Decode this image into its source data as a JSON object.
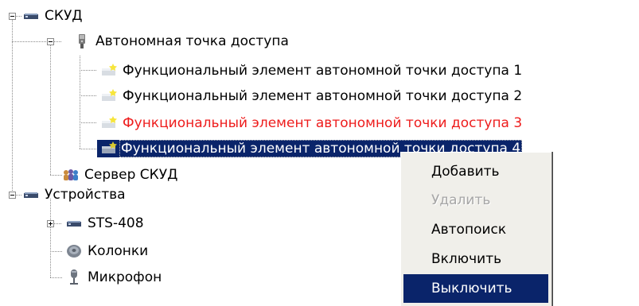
{
  "tree": {
    "nodes": [
      {
        "label": "СКУД",
        "icon": "device-icon",
        "expander": "minus"
      },
      {
        "label": "Автономная точка доступа",
        "icon": "access-point-icon",
        "expander": "minus"
      },
      {
        "label": "Функциональный элемент автономной точки доступа 1",
        "icon": "functional-element-icon"
      },
      {
        "label": "Функциональный элемент автономной точки доступа 2",
        "icon": "functional-element-icon"
      },
      {
        "label": "Функциональный элемент автономной точки доступа 3",
        "icon": "functional-element-icon",
        "status": "alarm",
        "status_color": "#ee1c1c"
      },
      {
        "label": "Функциональный элемент автономной точки доступа 4",
        "icon": "functional-element-icon",
        "selected": true
      },
      {
        "label": "Сервер СКУД",
        "icon": "server-users-icon"
      },
      {
        "label": "Устройства",
        "icon": "device-icon",
        "expander": "minus"
      },
      {
        "label": "STS-408",
        "icon": "device-icon",
        "expander": "plus"
      },
      {
        "label": "Колонки",
        "icon": "speaker-icon"
      },
      {
        "label": "Микрофон",
        "icon": "microphone-icon"
      }
    ]
  },
  "context_menu": {
    "items": [
      {
        "label": "Добавить",
        "enabled": true
      },
      {
        "label": "Удалить",
        "enabled": false
      },
      {
        "label": "Автопоиск",
        "enabled": true
      },
      {
        "label": "Включить",
        "enabled": true
      },
      {
        "label": "Выключить",
        "enabled": true,
        "highlighted": true
      }
    ]
  },
  "colors": {
    "selection": "#0a246a",
    "alarm_text": "#ee1c1c",
    "menu_background": "#f0efea",
    "disabled_text": "#a6a6a6"
  }
}
